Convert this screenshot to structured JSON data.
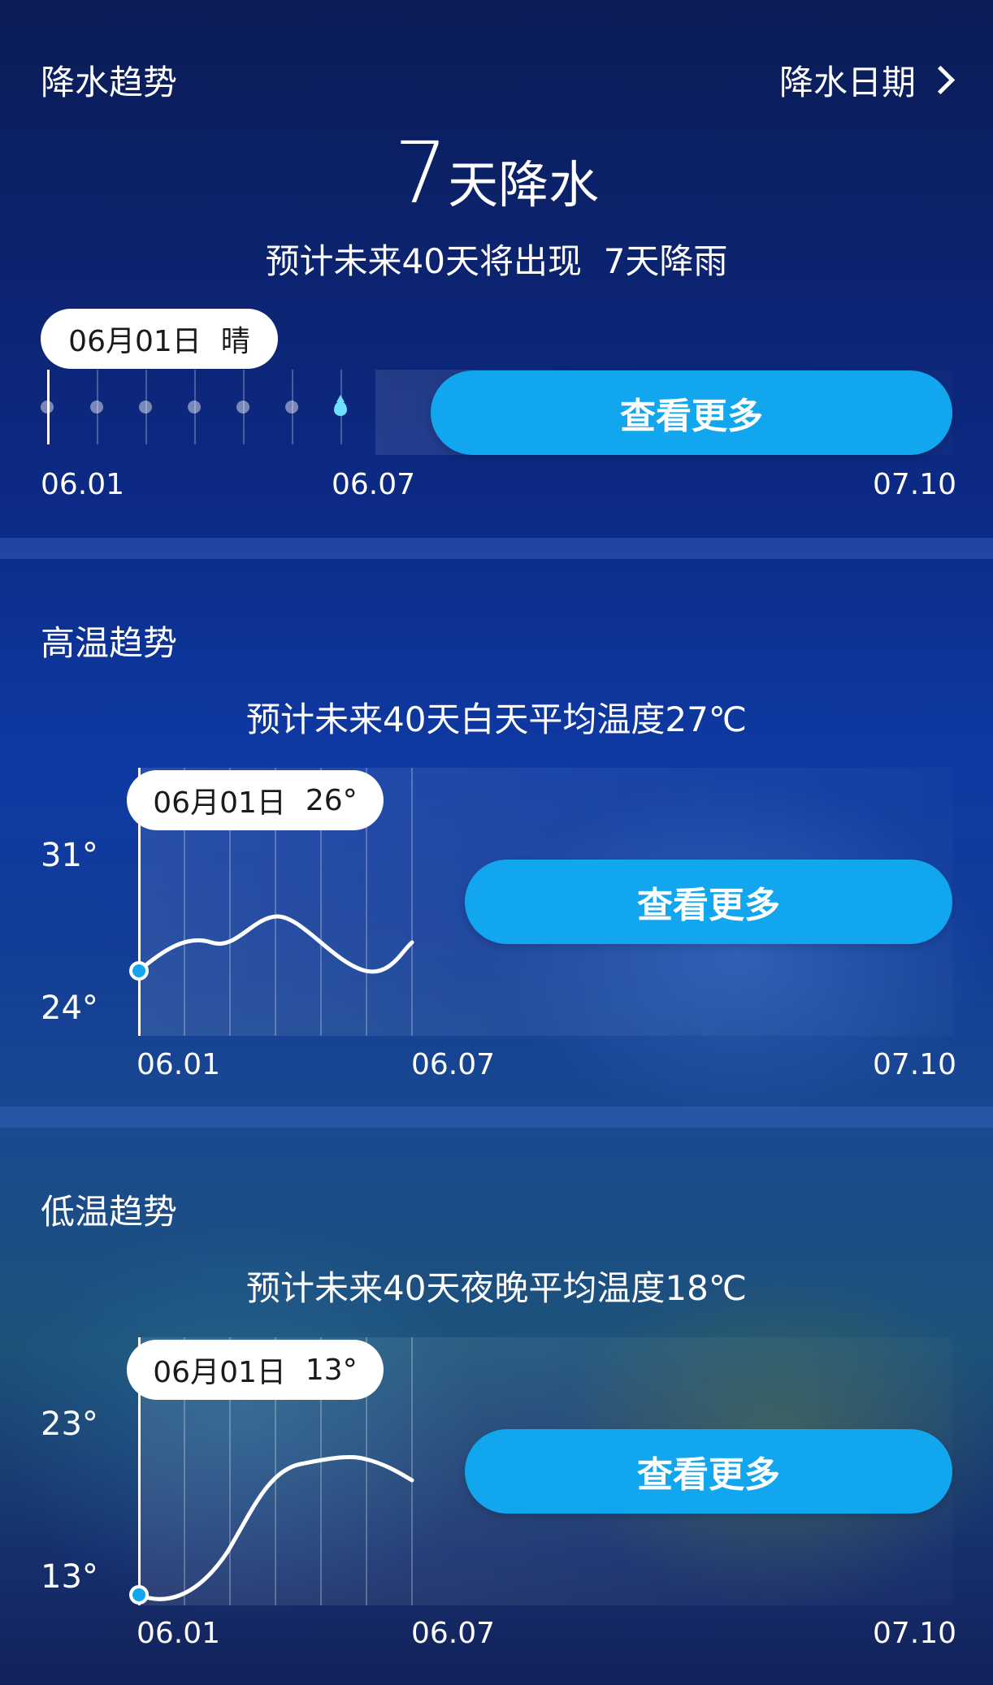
{
  "precip": {
    "title": "降水趋势",
    "link": "降水日期",
    "count": "7",
    "count_unit": "天降水",
    "summary_prefix": "预计未来40天将出现",
    "summary_value": "7天降雨",
    "pill_date": "06月01日",
    "pill_value": "晴",
    "button": "查看更多",
    "x_start": "06.01",
    "x_mid": "06.07",
    "x_end": "07.10"
  },
  "high": {
    "title": "高温趋势",
    "summary": "预计未来40天白天平均温度27℃",
    "pill_date": "06月01日",
    "pill_value": "26°",
    "y_top": "31°",
    "y_bottom": "24°",
    "button": "查看更多",
    "x_start": "06.01",
    "x_mid": "06.07",
    "x_end": "07.10"
  },
  "low": {
    "title": "低温趋势",
    "summary": "预计未来40天夜晚平均温度18℃",
    "pill_date": "06月01日",
    "pill_value": "13°",
    "y_top": "23°",
    "y_bottom": "13°",
    "button": "查看更多",
    "x_start": "06.01",
    "x_mid": "06.07",
    "x_end": "07.10"
  },
  "colors": {
    "accent": "#12a6ee",
    "droplet": "#6fe0ff"
  }
}
